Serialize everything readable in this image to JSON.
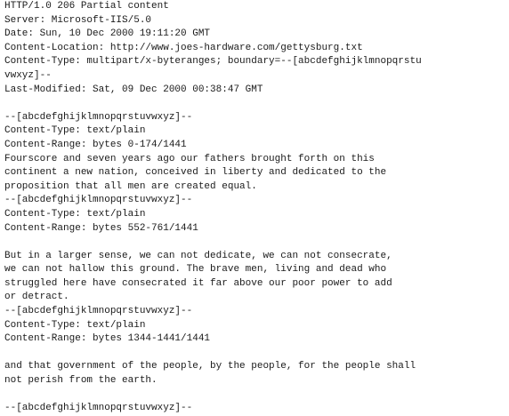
{
  "response_headers": [
    "HTTP/1.0 206 Partial content",
    "Server: Microsoft-IIS/5.0",
    "Date: Sun, 10 Dec 2000 19:11:20 GMT",
    "Content-Location: http://www.joes-hardware.com/gettysburg.txt",
    "Content-Type: multipart/x-byteranges; boundary=--[abcdefghijklmnopqrstu",
    "vwxyz]--",
    "Last-Modified: Sat, 09 Dec 2000 00:38:47 GMT"
  ],
  "parts": [
    {
      "boundary": "--[abcdefghijklmnopqrstuvwxyz]--",
      "content_type": "Content-Type: text/plain",
      "content_range": "Content-Range: bytes 0-174/1441",
      "body": [
        "Fourscore and seven years ago our fathers brought forth on this",
        "continent a new nation, conceived in liberty and dedicated to the",
        "proposition that all men are created equal."
      ]
    },
    {
      "boundary": "--[abcdefghijklmnopqrstuvwxyz]--",
      "content_type": "Content-Type: text/plain",
      "content_range": "Content-Range: bytes 552-761/1441",
      "body": [
        "But in a larger sense, we can not dedicate, we can not consecrate,",
        "we can not hallow this ground. The brave men, living and dead who",
        "struggled here have consecrated it far above our poor power to add",
        "or detract."
      ]
    },
    {
      "boundary": "--[abcdefghijklmnopqrstuvwxyz]--",
      "content_type": "Content-Type: text/plain",
      "content_range": "Content-Range: bytes 1344-1441/1441",
      "body": [
        "and that government of the people, by the people, for the people shall",
        "not perish from the earth."
      ]
    }
  ],
  "closing_boundary": "--[abcdefghijklmnopqrstuvwxyz]--"
}
